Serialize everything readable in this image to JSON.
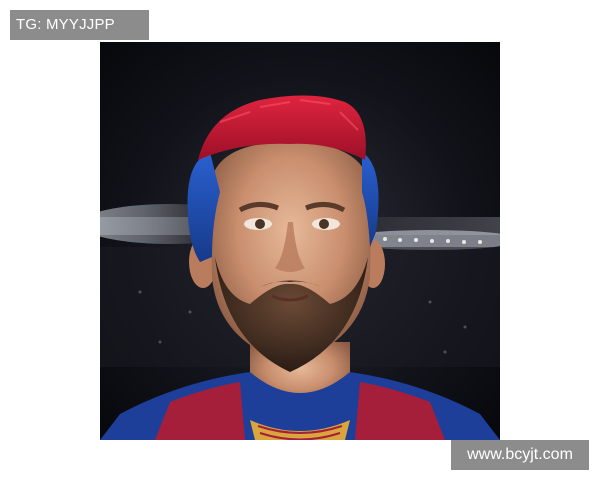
{
  "watermarks": {
    "top_left": "TG: MYYJJPP",
    "bottom_right": "www.bcyjt.com"
  },
  "photo": {
    "subject": "portrait-photo",
    "colors": {
      "hair_top": "#c0182f",
      "hair_sides": "#1f4fb5",
      "jersey_blue": "#1d3f9a",
      "jersey_red": "#a51f3a",
      "collar_gold": "#d9a53c",
      "background_dark": "#0b0c12",
      "stadium_lights": "#e6ecf5"
    }
  }
}
